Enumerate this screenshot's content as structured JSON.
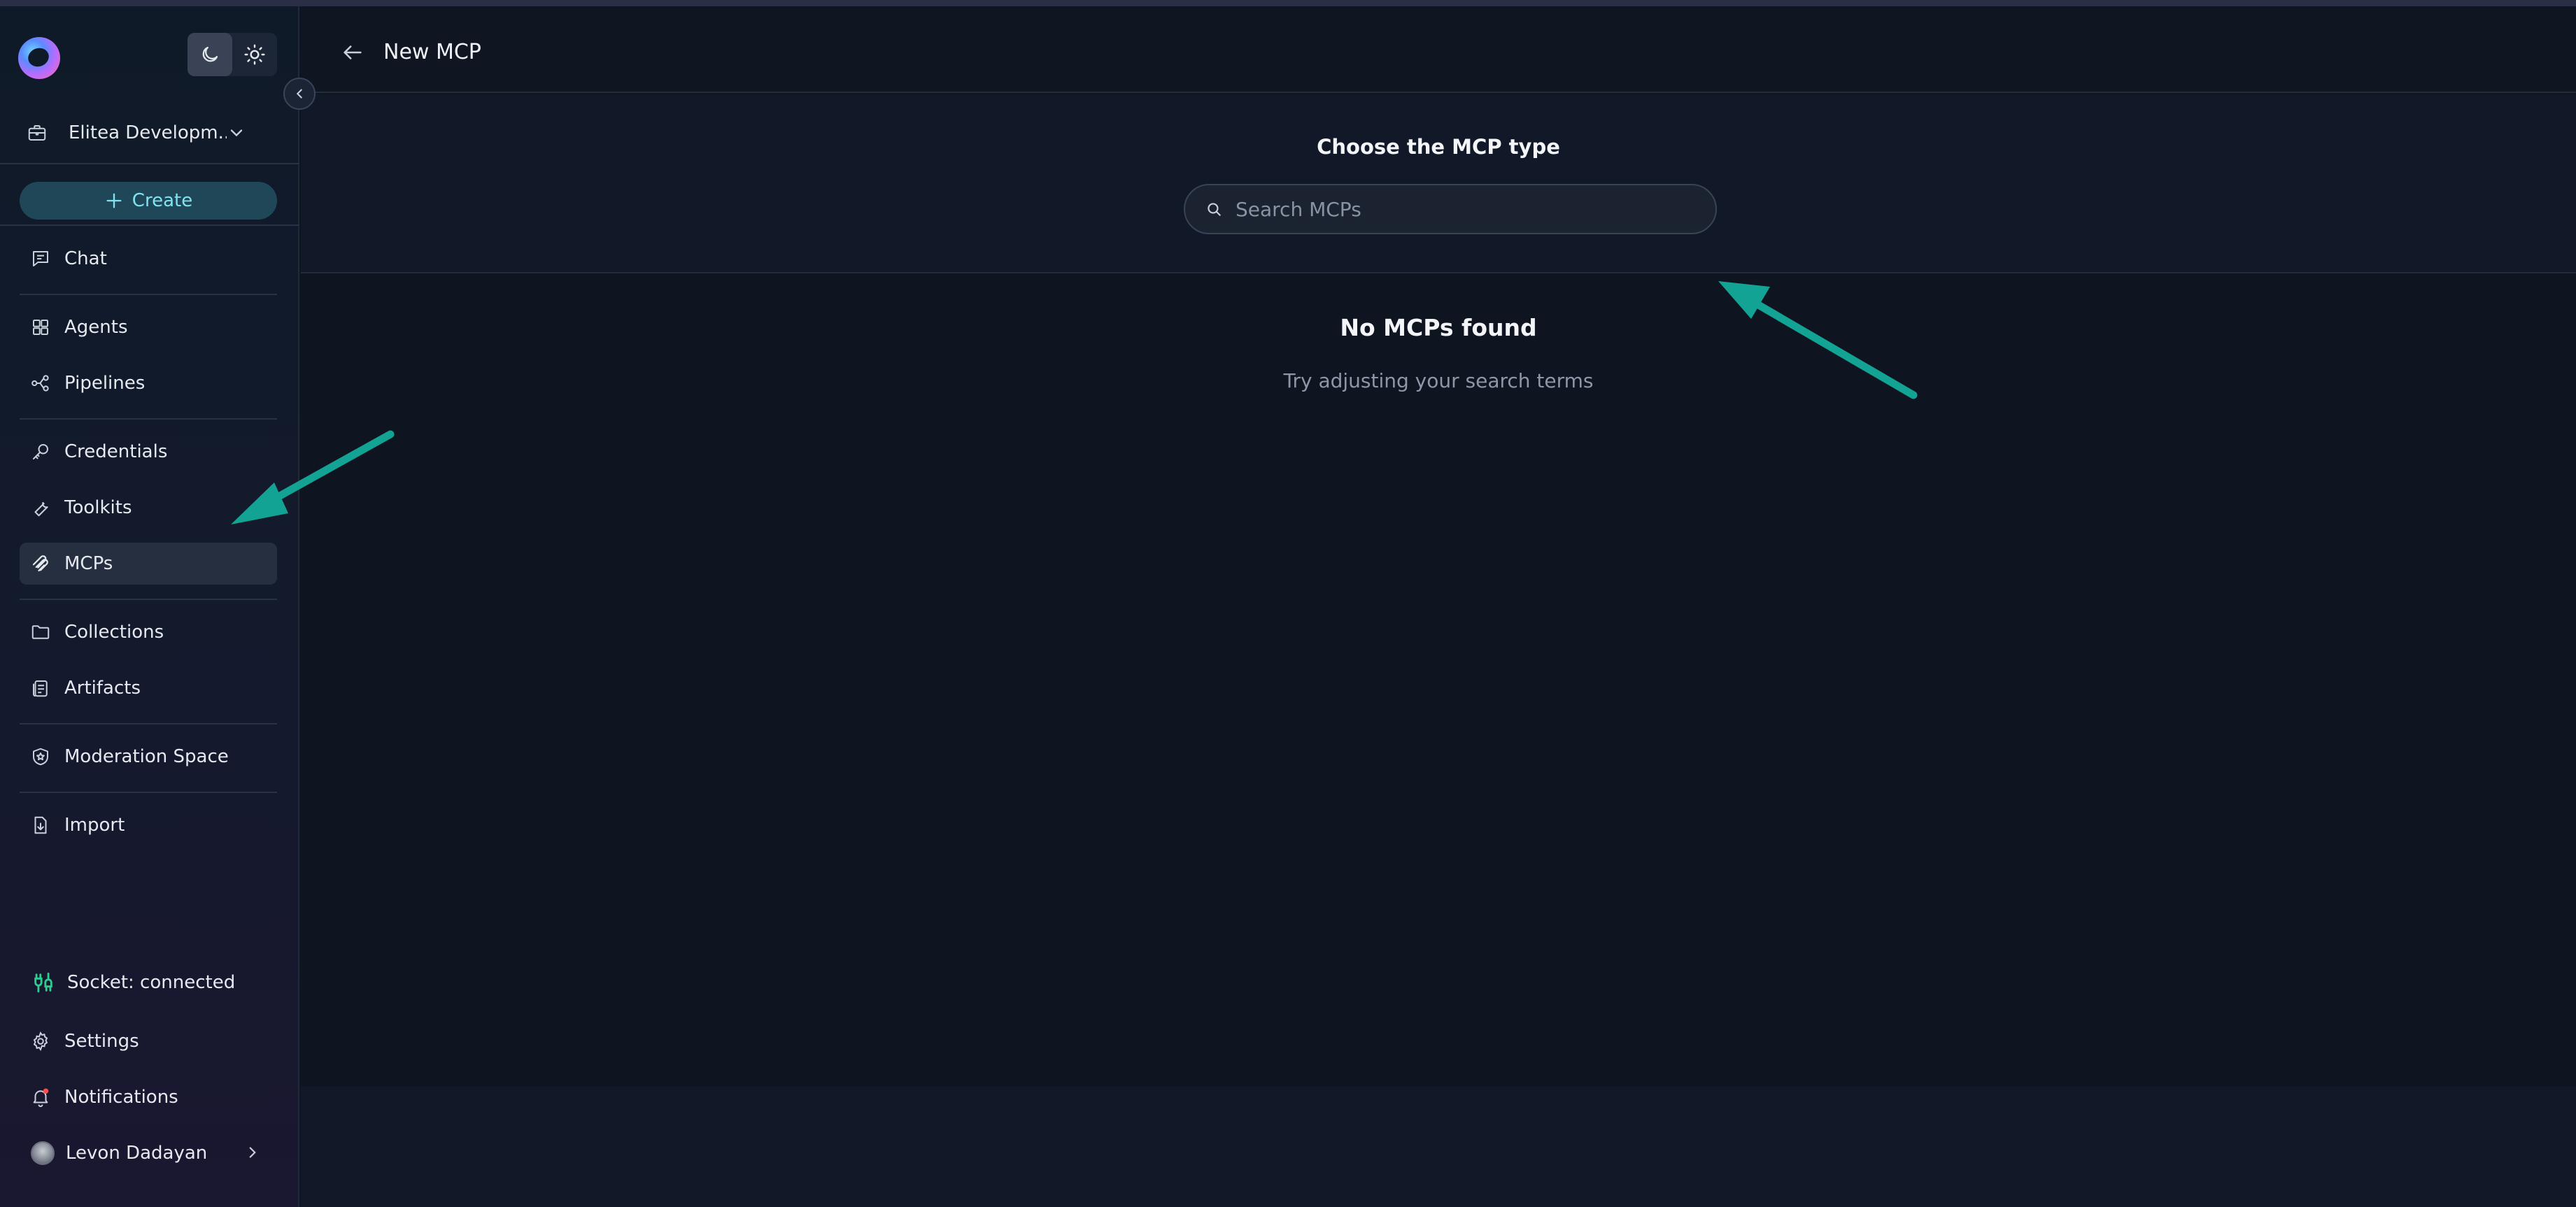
{
  "sidebar": {
    "project": "Elitea Developm...",
    "create_label": "Create",
    "nav": {
      "chat": "Chat",
      "agents": "Agents",
      "pipelines": "Pipelines",
      "credentials": "Credentials",
      "toolkits": "Toolkits",
      "mcps": "MCPs",
      "collections": "Collections",
      "artifacts": "Artifacts",
      "moderation": "Moderation Space",
      "import": "Import"
    },
    "socket_status": "Socket: connected",
    "settings": "Settings",
    "notifications": "Notifications",
    "user_name": "Levon Dadayan",
    "active_item": "MCPs"
  },
  "header": {
    "title": "New MCP"
  },
  "main": {
    "type_title": "Choose the MCP type",
    "search_placeholder": "Search MCPs",
    "search_value": "",
    "empty_title": "No MCPs found",
    "empty_subtitle": "Try adjusting your search terms"
  },
  "colors": {
    "accent": "#7fe3f2",
    "annotation_arrow": "#12a394",
    "socket_connected": "#2ecc8f",
    "notification_dot": "#ff4d4f"
  }
}
